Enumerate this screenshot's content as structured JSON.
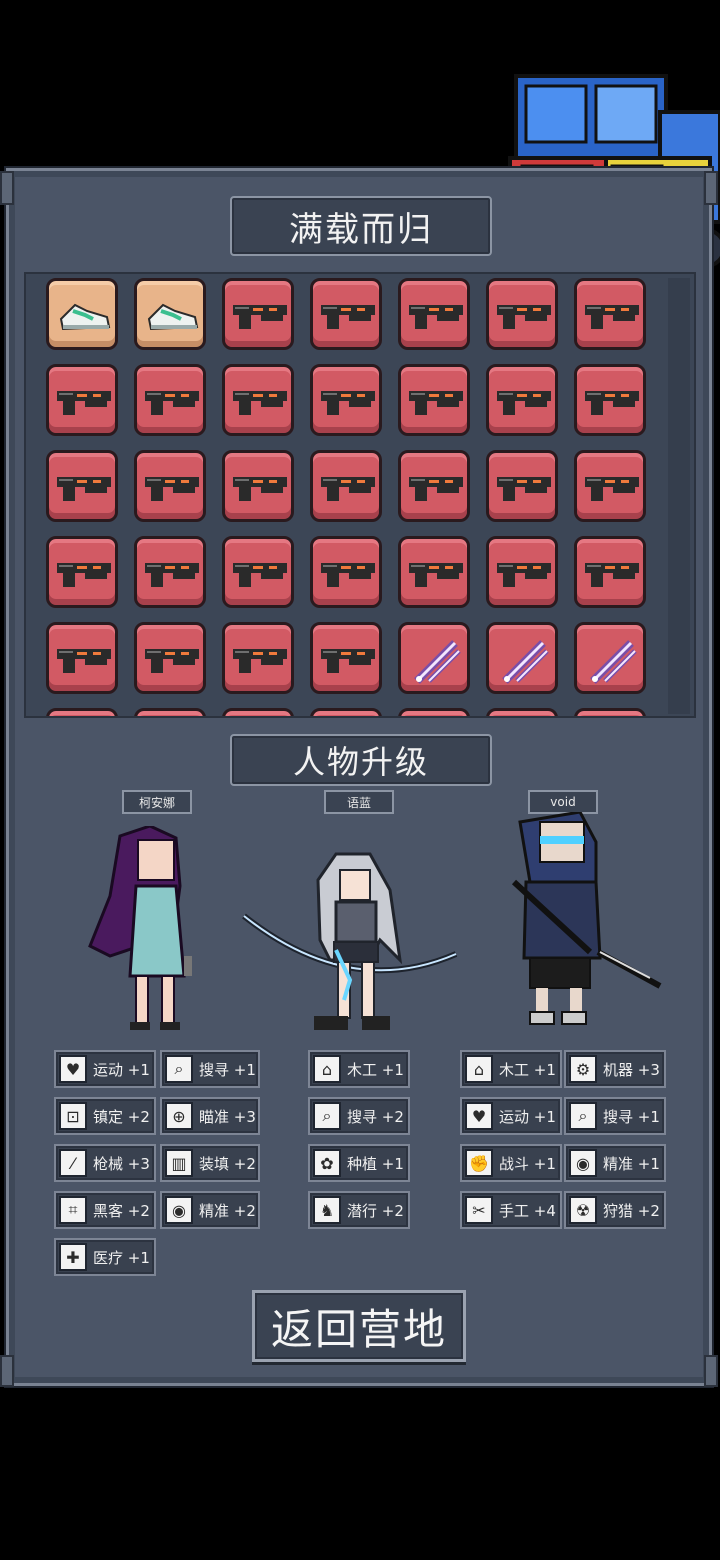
{
  "header": {
    "title": "满载而归"
  },
  "loot": {
    "rows": [
      [
        "sneaker-icon",
        "sneaker-icon",
        "gun-icon",
        "gun-icon",
        "gun-icon",
        "gun-icon",
        "gun-icon"
      ],
      [
        "gun-icon",
        "gun-icon",
        "gun-icon",
        "gun-icon",
        "gun-icon",
        "gun-icon",
        "gun-icon"
      ],
      [
        "gun-icon",
        "gun-icon",
        "gun-icon",
        "gun-icon",
        "gun-icon",
        "gun-icon",
        "gun-icon"
      ],
      [
        "gun-icon",
        "gun-icon",
        "gun-icon",
        "gun-icon",
        "gun-icon",
        "gun-icon",
        "gun-icon"
      ],
      [
        "gun-icon",
        "gun-icon",
        "gun-icon",
        "gun-icon",
        "blade-icon",
        "blade-icon",
        "blade-icon"
      ]
    ]
  },
  "upgrade": {
    "title": "人物升级"
  },
  "characters": [
    {
      "name": "柯安娜",
      "skills": [
        {
          "icon": "heart-icon",
          "label": "运动 +1"
        },
        {
          "icon": "magnifier-icon",
          "label": "搜寻 +1"
        },
        {
          "icon": "lock-icon",
          "label": "镇定 +2"
        },
        {
          "icon": "crosshair-icon",
          "label": "瞄准 +3"
        },
        {
          "icon": "knife-icon",
          "label": "枪械 +3"
        },
        {
          "icon": "magazine-icon",
          "label": "装填 +2"
        },
        {
          "icon": "circuit-icon",
          "label": "黑客 +2"
        },
        {
          "icon": "eye-icon",
          "label": "精准 +2"
        },
        {
          "icon": "medkit-icon",
          "label": "医疗 +1"
        }
      ]
    },
    {
      "name": "语蓝",
      "skills": [
        {
          "icon": "house-icon",
          "label": "木工 +1"
        },
        {
          "icon": "magnifier-icon",
          "label": "搜寻 +2"
        },
        {
          "icon": "plant-icon",
          "label": "种植 +1"
        },
        {
          "icon": "sneak-icon",
          "label": "潜行 +2"
        }
      ]
    },
    {
      "name": "void",
      "skills": [
        {
          "icon": "house-icon",
          "label": "木工 +1"
        },
        {
          "icon": "gear-icon",
          "label": "机器 +3"
        },
        {
          "icon": "heart-icon",
          "label": "运动 +1"
        },
        {
          "icon": "magnifier-icon",
          "label": "搜寻 +1"
        },
        {
          "icon": "fist-icon",
          "label": "战斗 +1"
        },
        {
          "icon": "eye-icon",
          "label": "精准 +1"
        },
        {
          "icon": "scissors-icon",
          "label": "手工 +4"
        },
        {
          "icon": "radiation-icon",
          "label": "狩猎 +2"
        }
      ]
    }
  ],
  "footer": {
    "return_label": "返回营地"
  }
}
